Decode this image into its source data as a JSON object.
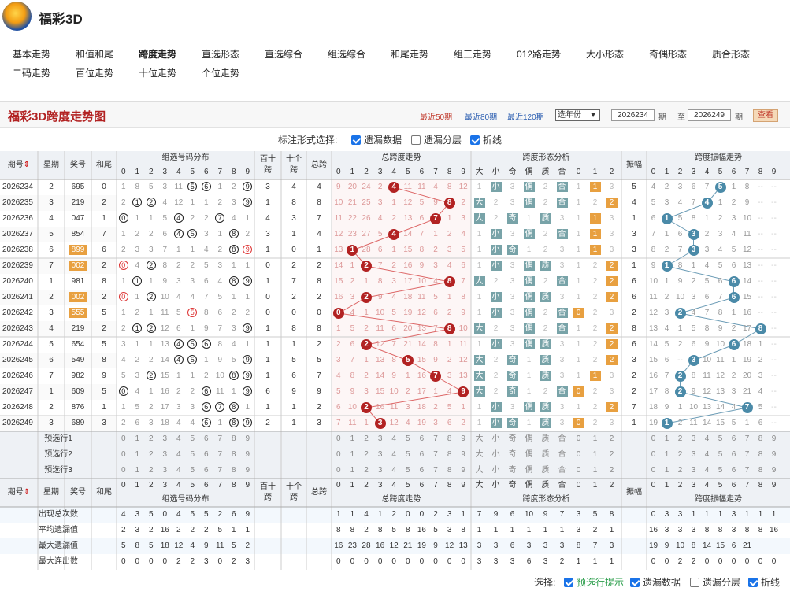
{
  "app": {
    "title": "福彩3D"
  },
  "nav": [
    "基本走势",
    "和值和尾",
    "跨度走势",
    "直选形态",
    "直选综合",
    "组选综合",
    "和尾走势",
    "组三走势",
    "012路走势",
    "大小形态",
    "奇偶形态",
    "质合形态",
    "二码走势",
    "百位走势",
    "十位走势",
    "个位走势"
  ],
  "nav_current": "跨度走势",
  "panel": {
    "title": "福彩3D跨度走势图",
    "range_links": [
      "最近50期",
      "最近80期",
      "最近120期"
    ],
    "range_current": "最近50期",
    "year_select": "选年份",
    "from_value": "2026234",
    "period_label": "期",
    "to_label": "至",
    "to_value": "2026249",
    "query_button": "查看"
  },
  "options": {
    "label": "标注形式选择:",
    "items": [
      {
        "label": "遗漏数据",
        "checked": true
      },
      {
        "label": "遗漏分层",
        "checked": false
      },
      {
        "label": "折线",
        "checked": true
      }
    ]
  },
  "bottom_options": {
    "label": "选择:",
    "items": [
      {
        "label": "预选行提示",
        "checked": true
      },
      {
        "label": "遗漏数据",
        "checked": true
      },
      {
        "label": "遗漏分层",
        "checked": false
      },
      {
        "label": "折线",
        "checked": true
      }
    ]
  },
  "headers": {
    "issue": "期号",
    "week": "星期",
    "number": "奖号",
    "sum_tail": "和尾",
    "group_dist": "组选号码分布",
    "bai_shi": "百十跨",
    "shi_ge": "十个跨",
    "total_span": "总跨",
    "total_trend": "总跨度走势",
    "span_form": "跨度形态分析",
    "amplitude": "振幅",
    "amp_trend": "跨度振幅走势",
    "form_labels": [
      "大",
      "小",
      "奇",
      "偶",
      "质",
      "合",
      "0",
      "1",
      "2"
    ]
  },
  "colors": {
    "ball": "#b22222",
    "blue": "#4a8aa8",
    "teal": "#78a3a8",
    "orange": "#e8a040"
  },
  "rows": [
    {
      "issue": "2026234",
      "week": "2",
      "num": "695",
      "tail": "0",
      "hit": [
        5,
        6,
        9
      ],
      "rep": [],
      "bs": "3",
      "sg": "4",
      "span": 4,
      "amp": "5",
      "form": [
        "",
        "小",
        "",
        "偶",
        "",
        "合",
        "",
        "1",
        ""
      ]
    },
    {
      "issue": "2026235",
      "week": "3",
      "num": "219",
      "tail": "2",
      "hit": [
        1,
        2,
        9
      ],
      "rep": [],
      "bs": "1",
      "sg": "8",
      "span": 8,
      "amp": "4",
      "form": [
        "大",
        "",
        "",
        "偶",
        "",
        "合",
        "",
        "",
        "2"
      ]
    },
    {
      "issue": "2026236",
      "week": "4",
      "num": "047",
      "tail": "1",
      "hit": [
        0,
        4,
        7
      ],
      "rep": [],
      "bs": "4",
      "sg": "3",
      "span": 7,
      "amp": "1",
      "form": [
        "大",
        "",
        "奇",
        "",
        "质",
        "",
        "",
        "1",
        ""
      ]
    },
    {
      "issue": "2026237",
      "week": "5",
      "num": "854",
      "tail": "7",
      "hit": [
        4,
        5,
        8
      ],
      "rep": [],
      "bs": "3",
      "sg": "1",
      "span": 4,
      "amp": "3",
      "form": [
        "",
        "小",
        "",
        "偶",
        "",
        "合",
        "",
        "1",
        ""
      ]
    },
    {
      "issue": "2026238",
      "week": "6",
      "num": "899",
      "tail": "6",
      "hit": [
        8,
        9
      ],
      "rep": [
        9
      ],
      "bs": "1",
      "sg": "0",
      "span": 1,
      "amp": "3",
      "form": [
        "",
        "小",
        "奇",
        "",
        "",
        "",
        "",
        "1",
        ""
      ],
      "orange": true
    },
    {
      "issue": "2026239",
      "week": "7",
      "num": "002",
      "tail": "2",
      "hit": [
        0,
        2
      ],
      "rep": [
        0
      ],
      "bs": "0",
      "sg": "2",
      "span": 2,
      "amp": "1",
      "form": [
        "",
        "小",
        "",
        "偶",
        "质",
        "",
        "",
        "",
        "2"
      ],
      "orange": true
    },
    {
      "issue": "2026240",
      "week": "1",
      "num": "981",
      "tail": "8",
      "hit": [
        1,
        8,
        9
      ],
      "rep": [],
      "bs": "1",
      "sg": "7",
      "span": 8,
      "amp": "6",
      "form": [
        "大",
        "",
        "",
        "偶",
        "",
        "合",
        "",
        "",
        "2"
      ]
    },
    {
      "issue": "2026241",
      "week": "2",
      "num": "002",
      "tail": "2",
      "hit": [
        0,
        2
      ],
      "rep": [
        0
      ],
      "bs": "0",
      "sg": "2",
      "span": 2,
      "amp": "6",
      "form": [
        "",
        "小",
        "",
        "偶",
        "质",
        "",
        "",
        "",
        "2"
      ],
      "orange": true
    },
    {
      "issue": "2026242",
      "week": "3",
      "num": "555",
      "tail": "5",
      "hit": [
        5
      ],
      "rep": [
        5
      ],
      "bs": "0",
      "sg": "0",
      "span": 0,
      "amp": "2",
      "form": [
        "",
        "小",
        "",
        "偶",
        "",
        "合",
        "0",
        "",
        ""
      ],
      "orange": true
    },
    {
      "issue": "2026243",
      "week": "4",
      "num": "219",
      "tail": "2",
      "hit": [
        1,
        2,
        9
      ],
      "rep": [],
      "bs": "1",
      "sg": "8",
      "span": 8,
      "amp": "8",
      "form": [
        "大",
        "",
        "",
        "偶",
        "",
        "合",
        "",
        "",
        "2"
      ]
    },
    {
      "issue": "2026244",
      "week": "5",
      "num": "654",
      "tail": "5",
      "hit": [
        4,
        5,
        6
      ],
      "rep": [],
      "bs": "1",
      "sg": "1",
      "span": 2,
      "amp": "6",
      "form": [
        "",
        "小",
        "",
        "偶",
        "质",
        "",
        "",
        "",
        "2"
      ]
    },
    {
      "issue": "2026245",
      "week": "6",
      "num": "549",
      "tail": "8",
      "hit": [
        4,
        5,
        9
      ],
      "rep": [],
      "bs": "1",
      "sg": "5",
      "span": 5,
      "amp": "3",
      "form": [
        "大",
        "",
        "奇",
        "",
        "质",
        "",
        "",
        "",
        "2"
      ]
    },
    {
      "issue": "2026246",
      "week": "7",
      "num": "982",
      "tail": "9",
      "hit": [
        2,
        8,
        9
      ],
      "rep": [],
      "bs": "1",
      "sg": "6",
      "span": 7,
      "amp": "2",
      "form": [
        "大",
        "",
        "奇",
        "",
        "质",
        "",
        "",
        "1",
        ""
      ]
    },
    {
      "issue": "2026247",
      "week": "1",
      "num": "609",
      "tail": "5",
      "hit": [
        0,
        6,
        9
      ],
      "rep": [],
      "bs": "6",
      "sg": "9",
      "span": 9,
      "amp": "2",
      "form": [
        "大",
        "",
        "奇",
        "",
        "",
        "合",
        "0",
        "",
        ""
      ]
    },
    {
      "issue": "2026248",
      "week": "2",
      "num": "876",
      "tail": "1",
      "hit": [
        6,
        7,
        8
      ],
      "rep": [],
      "bs": "1",
      "sg": "1",
      "span": 2,
      "amp": "7",
      "form": [
        "",
        "小",
        "",
        "偶",
        "质",
        "",
        "",
        "",
        "2"
      ]
    },
    {
      "issue": "2026249",
      "week": "3",
      "num": "689",
      "tail": "3",
      "hit": [
        6,
        8,
        9
      ],
      "rep": [],
      "bs": "2",
      "sg": "1",
      "span": 3,
      "amp": "1",
      "form": [
        "",
        "小",
        "奇",
        "",
        "质",
        "",
        "0",
        "",
        ""
      ]
    }
  ],
  "miss_dist": [
    [
      1,
      8,
      5,
      3,
      11,
      0,
      0,
      1,
      2,
      0
    ],
    [
      2,
      0,
      0,
      4,
      12,
      1,
      1,
      2,
      3,
      0
    ],
    [
      0,
      1,
      1,
      5,
      0,
      2,
      2,
      0,
      4,
      1
    ],
    [
      1,
      2,
      2,
      6,
      0,
      0,
      3,
      1,
      0,
      2
    ],
    [
      2,
      3,
      3,
      7,
      1,
      1,
      4,
      2,
      0,
      0
    ],
    [
      0,
      4,
      0,
      8,
      2,
      2,
      5,
      3,
      1,
      1
    ],
    [
      1,
      0,
      1,
      9,
      3,
      3,
      6,
      4,
      0,
      0
    ],
    [
      0,
      1,
      0,
      10,
      4,
      4,
      7,
      5,
      1,
      1
    ],
    [
      1,
      2,
      1,
      11,
      5,
      0,
      8,
      6,
      2,
      2
    ],
    [
      2,
      0,
      0,
      12,
      6,
      1,
      9,
      7,
      3,
      0
    ],
    [
      3,
      1,
      1,
      13,
      0,
      0,
      0,
      8,
      4,
      1
    ],
    [
      4,
      2,
      2,
      14,
      0,
      0,
      1,
      9,
      5,
      0
    ],
    [
      5,
      3,
      0,
      15,
      1,
      1,
      2,
      10,
      0,
      0
    ],
    [
      0,
      4,
      1,
      16,
      2,
      2,
      0,
      11,
      1,
      0
    ],
    [
      1,
      5,
      2,
      17,
      3,
      3,
      0,
      0,
      0,
      1
    ],
    [
      2,
      6,
      3,
      18,
      4,
      4,
      0,
      1,
      0,
      0
    ]
  ],
  "miss_span": [
    [
      9,
      20,
      24,
      2,
      0,
      11,
      11,
      4,
      8,
      12
    ],
    [
      10,
      21,
      25,
      3,
      1,
      12,
      5,
      9,
      0,
      2
    ],
    [
      11,
      22,
      26,
      4,
      2,
      13,
      6,
      0,
      1,
      3
    ],
    [
      12,
      23,
      27,
      5,
      0,
      14,
      7,
      1,
      2,
      4
    ],
    [
      13,
      0,
      28,
      6,
      1,
      15,
      8,
      2,
      3,
      5
    ],
    [
      14,
      1,
      0,
      7,
      2,
      16,
      9,
      3,
      4,
      6
    ],
    [
      15,
      2,
      1,
      8,
      3,
      17,
      10,
      4,
      0,
      7
    ],
    [
      16,
      3,
      0,
      9,
      4,
      18,
      11,
      5,
      1,
      8
    ],
    [
      0,
      4,
      1,
      10,
      5,
      19,
      12,
      6,
      2,
      9
    ],
    [
      1,
      5,
      2,
      11,
      6,
      20,
      13,
      7,
      0,
      10
    ],
    [
      2,
      6,
      0,
      12,
      7,
      21,
      14,
      8,
      1,
      11
    ],
    [
      3,
      7,
      1,
      13,
      8,
      0,
      15,
      9,
      2,
      12
    ],
    [
      4,
      8,
      2,
      14,
      9,
      1,
      16,
      0,
      3,
      13
    ],
    [
      5,
      9,
      3,
      15,
      10,
      2,
      17,
      1,
      4,
      0
    ],
    [
      6,
      10,
      0,
      16,
      11,
      3,
      18,
      2,
      5,
      1
    ],
    [
      7,
      11,
      1,
      0,
      12,
      4,
      19,
      3,
      6,
      2
    ]
  ],
  "miss_amp": [
    [
      4,
      2,
      3,
      6,
      7,
      0,
      1,
      8,
      0,
      0
    ],
    [
      5,
      3,
      4,
      7,
      0,
      1,
      2,
      9,
      0,
      0
    ],
    [
      6,
      0,
      5,
      8,
      1,
      2,
      3,
      10,
      0,
      0
    ],
    [
      7,
      1,
      6,
      0,
      2,
      3,
      4,
      11,
      0,
      0
    ],
    [
      8,
      2,
      7,
      0,
      3,
      4,
      5,
      12,
      0,
      0
    ],
    [
      9,
      0,
      8,
      1,
      4,
      5,
      6,
      13,
      0,
      0
    ],
    [
      10,
      1,
      9,
      2,
      5,
      6,
      0,
      14,
      0,
      0
    ],
    [
      11,
      2,
      10,
      3,
      6,
      7,
      0,
      15,
      0,
      0
    ],
    [
      12,
      3,
      0,
      4,
      7,
      8,
      1,
      16,
      0,
      0
    ],
    [
      13,
      4,
      1,
      5,
      8,
      9,
      2,
      17,
      0,
      0
    ],
    [
      14,
      5,
      2,
      6,
      9,
      10,
      0,
      18,
      1,
      0
    ],
    [
      15,
      6,
      0,
      7,
      10,
      11,
      1,
      19,
      2,
      0
    ],
    [
      16,
      7,
      0,
      8,
      11,
      12,
      2,
      20,
      3,
      0
    ],
    [
      17,
      8,
      0,
      9,
      12,
      13,
      3,
      21,
      4,
      0
    ],
    [
      18,
      9,
      1,
      10,
      13,
      14,
      4,
      0,
      5,
      0
    ],
    [
      19,
      0,
      2,
      11,
      14,
      15,
      5,
      1,
      6,
      0
    ]
  ],
  "amp_hits": [
    5,
    4,
    1,
    3,
    3,
    1,
    6,
    6,
    2,
    8,
    6,
    3,
    2,
    2,
    7,
    1
  ],
  "preview_rows": [
    "预选行1",
    "预选行2",
    "预选行3"
  ],
  "stats": [
    {
      "label": "出现总次数",
      "dist": [
        "4",
        "3",
        "5",
        "0",
        "4",
        "5",
        "5",
        "2",
        "6",
        "9"
      ],
      "span": [
        "1",
        "1",
        "4",
        "1",
        "2",
        "0",
        "0",
        "2",
        "3",
        "1"
      ],
      "form": [
        "7",
        "9",
        "6",
        "10",
        "9",
        "7",
        "3",
        "5",
        "8"
      ],
      "amp": [
        "0",
        "3",
        "3",
        "1",
        "1",
        "1",
        "3",
        "1",
        "1",
        "1"
      ]
    },
    {
      "label": "平均遗漏值",
      "dist": [
        "2",
        "3",
        "2",
        "16",
        "2",
        "2",
        "2",
        "5",
        "1",
        "1"
      ],
      "span": [
        "8",
        "8",
        "2",
        "8",
        "5",
        "8",
        "16",
        "5",
        "3",
        "8"
      ],
      "form": [
        "1",
        "1",
        "1",
        "1",
        "1",
        "1",
        "3",
        "2",
        "1"
      ],
      "amp": [
        "16",
        "3",
        "3",
        "3",
        "8",
        "8",
        "3",
        "8",
        "8",
        "16"
      ]
    },
    {
      "label": "最大遗漏值",
      "dist": [
        "5",
        "8",
        "5",
        "18",
        "12",
        "4",
        "9",
        "11",
        "5",
        "2"
      ],
      "span": [
        "16",
        "23",
        "28",
        "16",
        "12",
        "21",
        "19",
        "9",
        "12",
        "13"
      ],
      "form": [
        "3",
        "3",
        "6",
        "3",
        "3",
        "3",
        "8",
        "7",
        "3"
      ],
      "amp": [
        "19",
        "9",
        "10",
        "8",
        "14",
        "15",
        "6",
        "21",
        "",
        ""
      ]
    },
    {
      "label": "最大连出数",
      "dist": [
        "0",
        "0",
        "0",
        "0",
        "2",
        "2",
        "3",
        "0",
        "2",
        "3"
      ],
      "span": [
        "0",
        "0",
        "0",
        "0",
        "0",
        "0",
        "0",
        "0",
        "0",
        "0"
      ],
      "form": [
        "3",
        "3",
        "3",
        "6",
        "3",
        "2",
        "1",
        "1",
        "1"
      ],
      "amp": [
        "0",
        "0",
        "2",
        "2",
        "0",
        "0",
        "0",
        "0",
        "0",
        "0"
      ]
    }
  ]
}
